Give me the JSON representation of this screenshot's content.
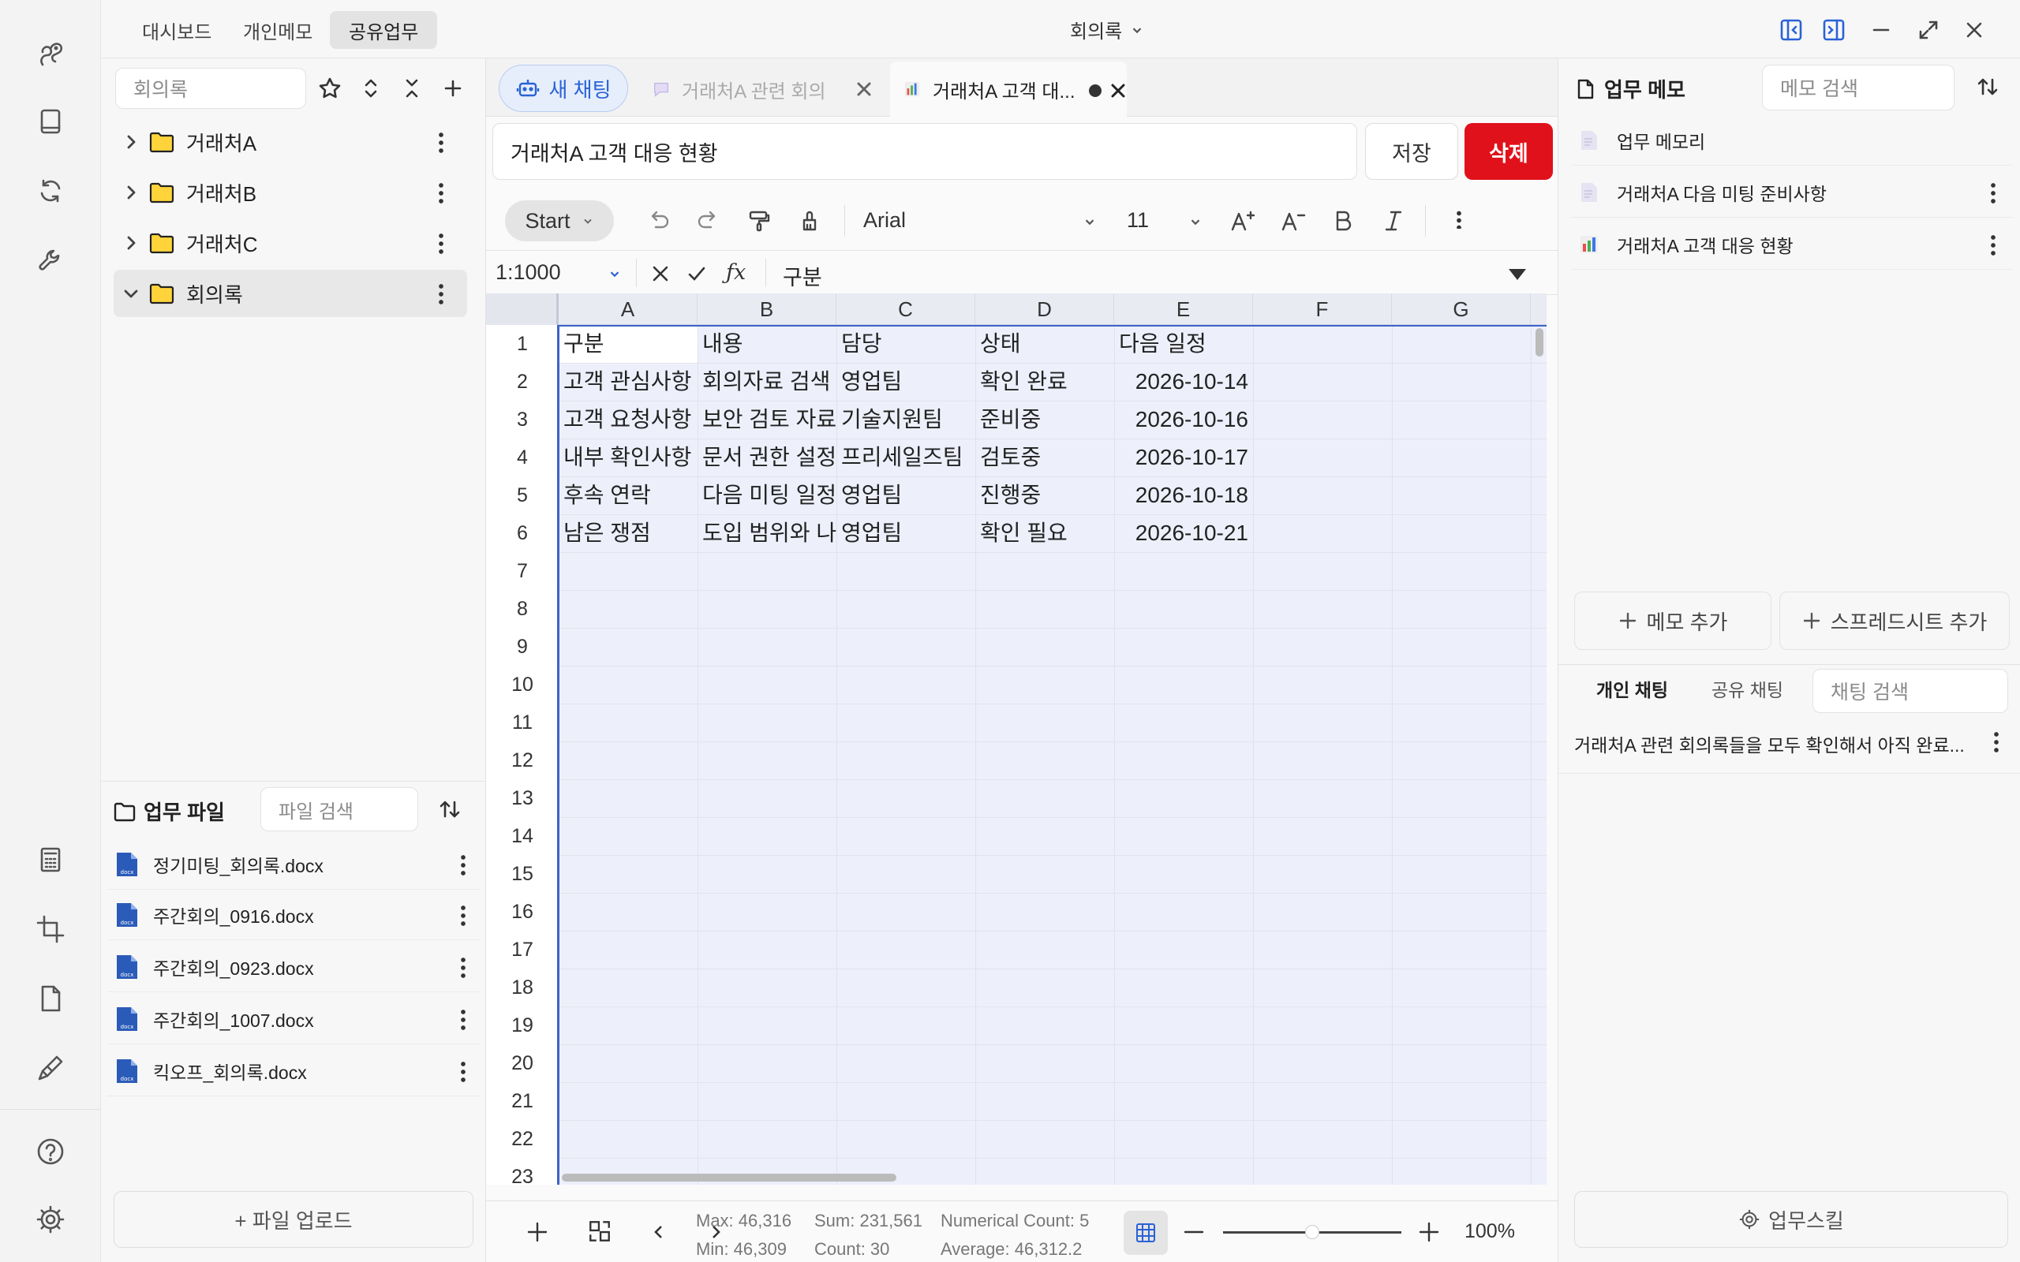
{
  "topbar": {
    "tabs": [
      "대시보드",
      "개인메모",
      "공유업무"
    ],
    "center_title": "회의록"
  },
  "left": {
    "search_placeholder": "회의록",
    "folders": [
      "거래처A",
      "거래처B",
      "거래처C",
      "회의록"
    ],
    "files_title": "업무 파일",
    "file_search_placeholder": "파일 검색",
    "files": [
      "정기미팅_회의록.docx",
      "주간회의_0916.docx",
      "주간회의_0923.docx",
      "주간회의_1007.docx",
      "킥오프_회의록.docx"
    ],
    "upload_label": "+ 파일 업로드"
  },
  "tabs": {
    "new_chat": "새 채팅",
    "tab1": "거래처A 관련 회의",
    "tab2": "거래처A 고객 대..."
  },
  "doc": {
    "title": "거래처A 고객 대응 현황",
    "save": "저장",
    "delete": "삭제"
  },
  "toolbar": {
    "start": "Start",
    "font": "Arial",
    "size": "11"
  },
  "formula": {
    "range": "1:1000",
    "content": "구분"
  },
  "sheet": {
    "columns": [
      "A",
      "B",
      "C",
      "D",
      "E",
      "F",
      "G"
    ],
    "rows": [
      "1",
      "2",
      "3",
      "4",
      "5",
      "6",
      "7",
      "8",
      "9",
      "10",
      "11",
      "12",
      "13",
      "14",
      "15",
      "16",
      "17",
      "18",
      "19",
      "20",
      "21",
      "22",
      "23"
    ],
    "cells": [
      [
        "구분",
        "내용",
        "담당",
        "상태",
        "다음 일정"
      ],
      [
        "고객 관심사항",
        "회의자료 검색",
        "영업팀",
        "확인 완료",
        "2026-10-14"
      ],
      [
        "고객 요청사항",
        "보안 검토 자료",
        "기술지원팀",
        "준비중",
        "2026-10-16"
      ],
      [
        "내부 확인사항",
        "문서 권한 설정",
        "프리세일즈팀",
        "검토중",
        "2026-10-17"
      ],
      [
        "후속 연락",
        "다음 미팅 일정",
        "영업팀",
        "진행중",
        "2026-10-18"
      ],
      [
        "남은 쟁점",
        "도입 범위와 나",
        "영업팀",
        "확인 필요",
        "2026-10-21"
      ]
    ]
  },
  "status": {
    "max": "Max: 46,316",
    "sum": "Sum: 231,561",
    "num_count": "Numerical Count: 5",
    "min": "Min: 46,309",
    "count": "Count: 30",
    "avg": "Average: 46,312.2",
    "zoom": "100%"
  },
  "right": {
    "memo_title": "업무 메모",
    "memo_search_placeholder": "메모 검색",
    "memos": [
      "업무 메모리",
      "거래처A 다음 미팅 준비사항",
      "거래처A 고객 대응 현황"
    ],
    "add_memo": "메모 추가",
    "add_sheet": "스프레드시트 추가",
    "chat_tabs": [
      "개인 채팅",
      "공유 채팅"
    ],
    "chat_search_placeholder": "채팅 검색",
    "chat_item": "거래처A 관련 회의록들을 모두 확인해서 아직 완료...",
    "skill": "업무스킬"
  },
  "colors": {
    "accent": "#2a62d6",
    "danger": "#e0111a",
    "selection": "#edf0fb"
  }
}
